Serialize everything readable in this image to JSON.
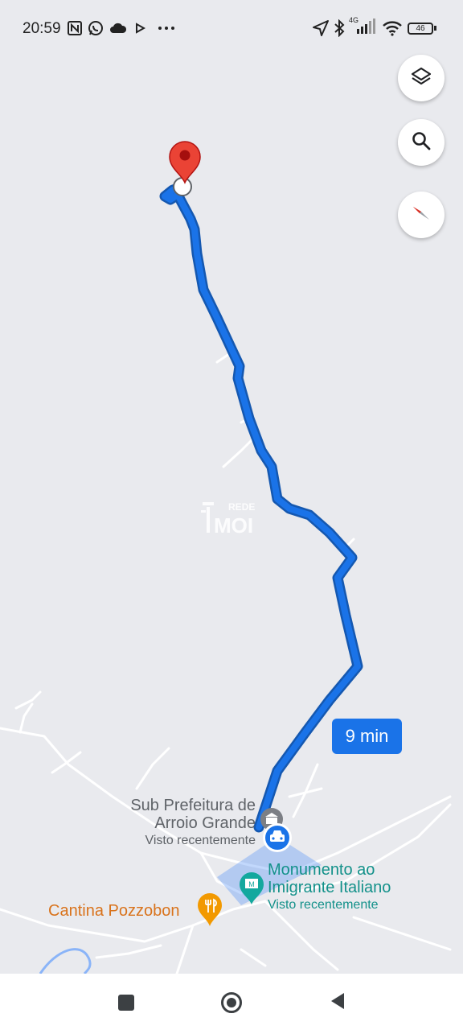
{
  "status_bar": {
    "time": "20:59",
    "network": "4G",
    "battery": "46",
    "left_icons": [
      "nfc-icon",
      "whatsapp-icon",
      "cloud-icon",
      "play-icon",
      "more-dots-icon"
    ],
    "right_icons": [
      "location-arrow-icon",
      "bluetooth-icon",
      "signal-icon",
      "wifi-icon",
      "battery-icon"
    ]
  },
  "map": {
    "route_color": "#1a73e8",
    "route_duration": "9 min",
    "watermark": {
      "line1": "REDE",
      "line2": "MOI"
    },
    "places": [
      {
        "name_lines": [
          "Sub Prefeitura de",
          "Arroio Grande"
        ],
        "subtitle": "Visto recentemente",
        "color": "#5f6368"
      },
      {
        "name_lines": [
          "Monumento ao",
          "Imigrante Italiano"
        ],
        "subtitle": "Visto recentemente",
        "color": "#13918a"
      },
      {
        "name_lines": [
          "Cantina Pozzobon"
        ],
        "subtitle": "",
        "color": "#d9731c"
      }
    ]
  },
  "controls": [
    "layers-icon",
    "search-icon",
    "compass-icon"
  ],
  "nav_bar": [
    "recent-apps-button",
    "home-button",
    "back-button"
  ]
}
